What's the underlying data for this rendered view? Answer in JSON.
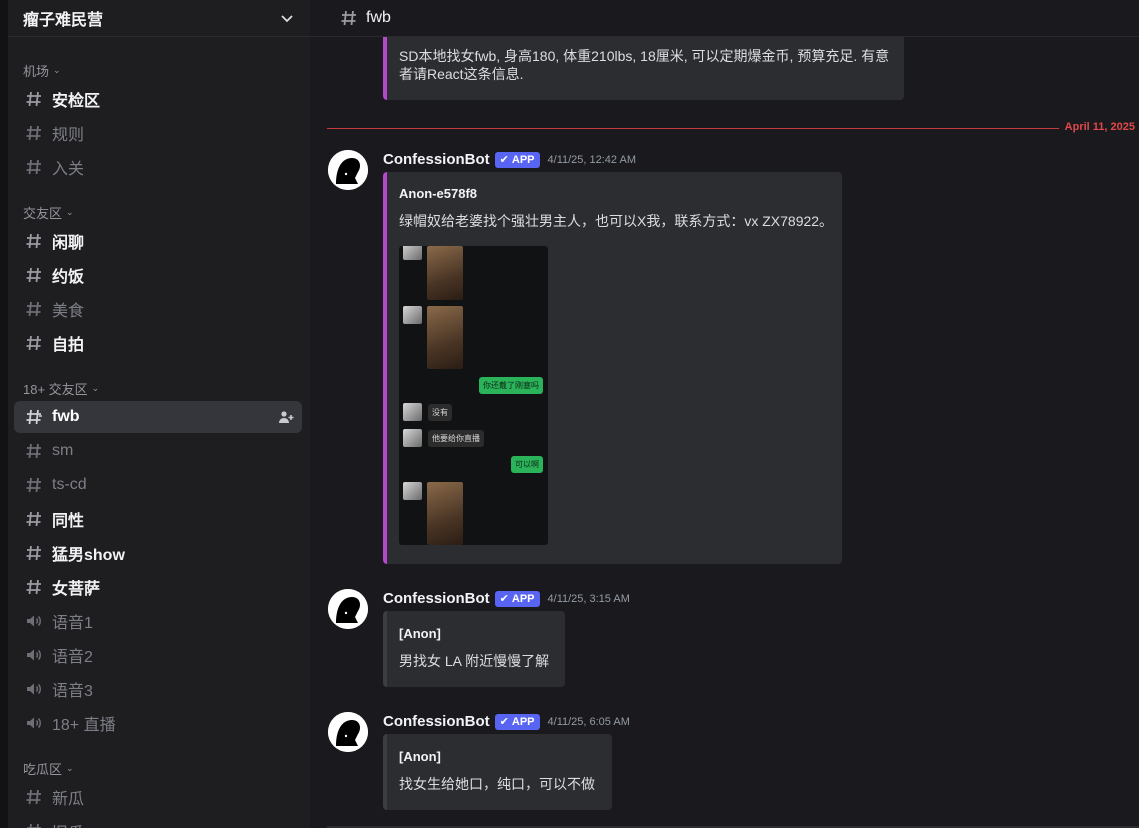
{
  "server": {
    "name": "瘤子难民营"
  },
  "categories": [
    {
      "label": "机场"
    },
    {
      "label": "交友区"
    },
    {
      "label": "18+ 交友区"
    },
    {
      "label": "吃瓜区"
    }
  ],
  "channels": [
    {
      "label": "安检区",
      "type": "text",
      "state": "unread"
    },
    {
      "label": "规则",
      "type": "text",
      "state": "muted"
    },
    {
      "label": "入关",
      "type": "text",
      "state": "muted"
    },
    {
      "label": "闲聊",
      "type": "text",
      "state": "unread"
    },
    {
      "label": "约饭",
      "type": "text",
      "state": "unread"
    },
    {
      "label": "美食",
      "type": "text",
      "state": "muted"
    },
    {
      "label": "自拍",
      "type": "text",
      "state": "unread"
    },
    {
      "label": "fwb",
      "type": "nsfw",
      "state": "active"
    },
    {
      "label": "sm",
      "type": "nsfw",
      "state": "muted"
    },
    {
      "label": "ts-cd",
      "type": "nsfw",
      "state": "muted"
    },
    {
      "label": "同性",
      "type": "nsfw",
      "state": "unread"
    },
    {
      "label": "猛男show",
      "type": "nsfw",
      "state": "unread"
    },
    {
      "label": "女菩萨",
      "type": "nsfw",
      "state": "unread"
    },
    {
      "label": "语音1",
      "type": "voice",
      "state": "muted"
    },
    {
      "label": "语音2",
      "type": "voice",
      "state": "muted"
    },
    {
      "label": "语音3",
      "type": "voice",
      "state": "muted"
    },
    {
      "label": "18+ 直播",
      "type": "voice",
      "state": "muted"
    },
    {
      "label": "新瓜",
      "type": "text",
      "state": "muted"
    },
    {
      "label": "旧瓜",
      "type": "text",
      "state": "muted"
    }
  ],
  "topbar": {
    "channel": "fwb"
  },
  "date_divider": "April 11, 2025",
  "top_embed": {
    "text": "SD本地找女fwb, 身高180, 体重210lbs, 18厘米, 可以定期爆金币, 预算充足. 有意者请React这条信息."
  },
  "messages": [
    {
      "author": "ConfessionBot",
      "badge": "APP",
      "time": "4/11/25, 12:42 AM",
      "embed_author": "Anon-e578f8",
      "embed_text": "绿帽奴给老婆找个强壮男主人，也可以X我，联系方式：vx ZX78922。",
      "chat": {
        "out1": "你还戴了刚塞吗",
        "in1": "没有",
        "in2": "他要给你直播",
        "out2": "可以啊"
      }
    },
    {
      "author": "ConfessionBot",
      "badge": "APP",
      "time": "4/11/25, 3:15 AM",
      "embed_author": "[Anon]",
      "embed_text": "男找女 LA 附近慢慢了解"
    },
    {
      "author": "ConfessionBot",
      "badge": "APP",
      "time": "4/11/25, 6:05 AM",
      "embed_author": "[Anon]",
      "embed_text": "找女生给她口，纯口，可以不做"
    }
  ],
  "colors": {
    "accent": "#5865f2",
    "embed_bar": "#b348c9",
    "divider": "#e0484a",
    "bubble_out": "#2bb35a"
  }
}
